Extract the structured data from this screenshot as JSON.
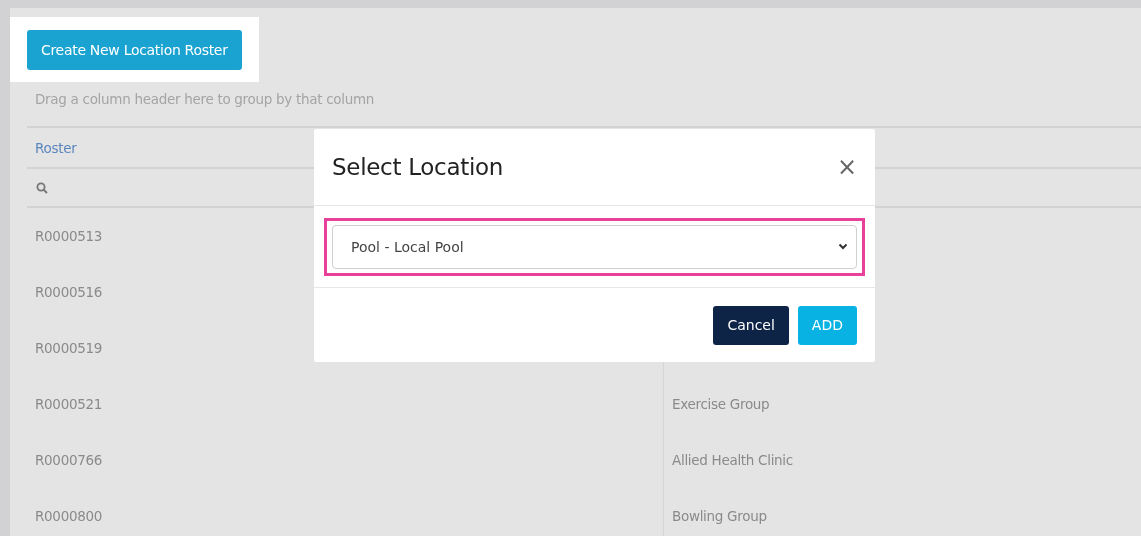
{
  "create_button": {
    "label": "Create New Location Roster",
    "highlighted": true
  },
  "group_hint": "Drag a column header here to group by that column",
  "table": {
    "columns": [
      "Roster"
    ],
    "rows": [
      {
        "roster": "R0000513"
      },
      {
        "roster": "R0000516"
      },
      {
        "roster": "R0000519"
      },
      {
        "roster": "R0000521",
        "column_2": "Exercise Group"
      },
      {
        "roster": "R0000766",
        "column_2": "Allied Health Clinic"
      },
      {
        "roster": "R0000800",
        "column_2": "Bowling Group"
      }
    ]
  },
  "dialog": {
    "title": "Select Location",
    "close": "×",
    "location_select": {
      "value": "Pool - Local Pool",
      "highlighted": true
    },
    "buttons": [
      {
        "kind": "secondary",
        "label": "Cancel"
      },
      {
        "kind": "primary",
        "label": "ADD"
      }
    ]
  }
}
